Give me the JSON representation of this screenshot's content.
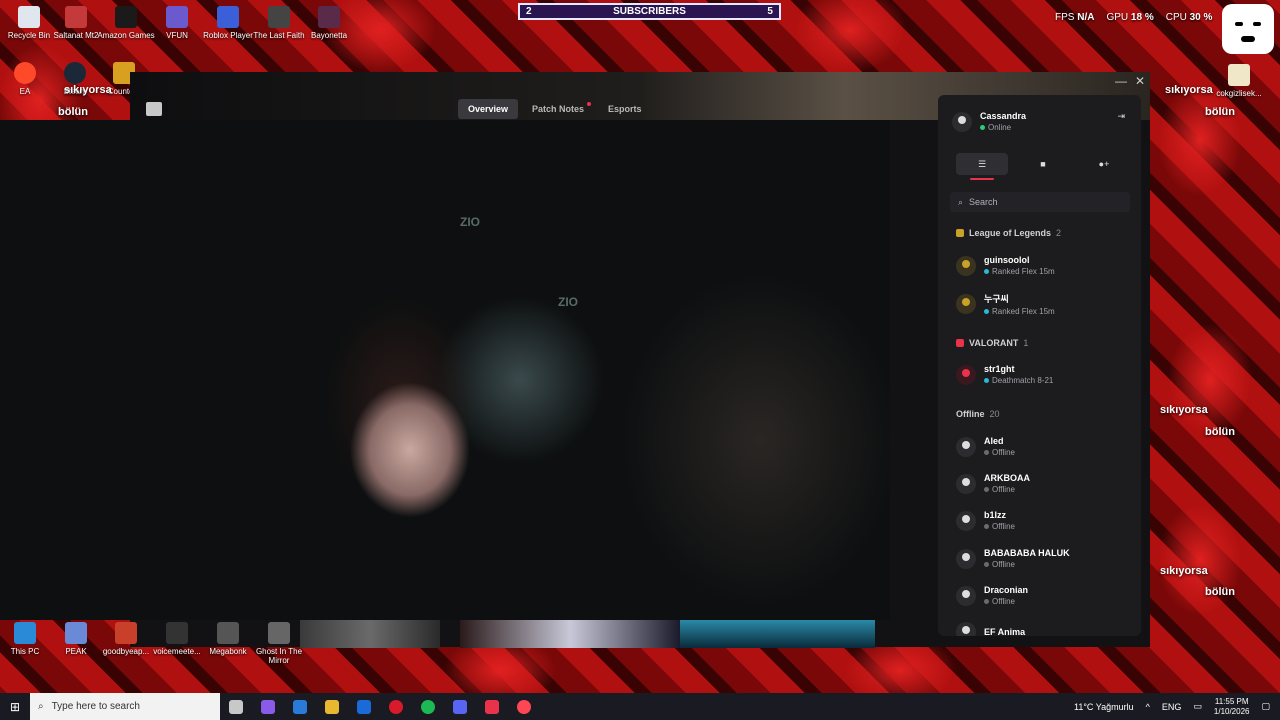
{
  "desktop_icons_top": [
    {
      "label": "Recycle Bin",
      "color": "#dfe6ee"
    },
    {
      "label": "Saltanat Mt2",
      "color": "#c43a3a"
    },
    {
      "label": "Amazon Games",
      "color": "#1a1a1a"
    },
    {
      "label": "VFUN",
      "color": "#6a5acd"
    },
    {
      "label": "Roblox Player",
      "color": "#3a5fd9"
    },
    {
      "label": "The Last Faith",
      "color": "#444"
    },
    {
      "label": "Bayonetta",
      "color": "#5a2a4a"
    }
  ],
  "desktop_icons_second": [
    {
      "label": "EA",
      "color": "#ff4a2a"
    },
    {
      "label": "Steam",
      "color": "#1b2838"
    },
    {
      "label": "Counte...",
      "color": "#d8a020"
    }
  ],
  "desktop_icons_bottom": [
    {
      "label": "This PC",
      "color": "#2a8ad8"
    },
    {
      "label": "PEAK",
      "color": "#6a8ad8"
    },
    {
      "label": "goodbyeap...",
      "color": "#c8402a"
    },
    {
      "label": "voicemeete...",
      "color": "#333"
    },
    {
      "label": "Megabonk",
      "color": "#555"
    },
    {
      "label": "Ghost In The Mirror",
      "color": "#666"
    }
  ],
  "overlay": {
    "subs_left": "2",
    "subs_label": "SUBSCRIBERS",
    "subs_right": "5",
    "fps_label": "FPS",
    "fps_value": "N/A",
    "gpu_label": "GPU",
    "gpu_value": "18 %",
    "cpu_label": "CPU",
    "cpu_value": "30 %",
    "side_text_1": "sıkıyorsa",
    "side_text_2": "bölün",
    "right_icon_label": "cokgizlisek..."
  },
  "client": {
    "tabs": [
      {
        "label": "Overview",
        "active": true
      },
      {
        "label": "Patch Notes",
        "active": false,
        "dot": true
      },
      {
        "label": "Esports",
        "active": false
      }
    ],
    "minimize": "—",
    "close": "✕",
    "video_mark": "ZIO"
  },
  "friends": {
    "me": {
      "name": "Cassandra",
      "status": "Online"
    },
    "collapse_icon": "⇥",
    "search_placeholder": "Search",
    "groups": {
      "lol": {
        "name": "League of Legends",
        "count": "2"
      },
      "valorant": {
        "name": "VALORANT",
        "count": "1"
      },
      "offline": {
        "name": "Offline",
        "count": "20"
      }
    },
    "lol_friends": [
      {
        "name": "guinsoolol",
        "status": "Ranked Flex 15m"
      },
      {
        "name": "누구씨",
        "status": "Ranked Flex 15m"
      }
    ],
    "valorant_friends": [
      {
        "name": "str1ght",
        "status": "Deathmatch 8-21"
      }
    ],
    "offline_friends": [
      {
        "name": "Aled",
        "status": "Offline"
      },
      {
        "name": "ARKBOAA",
        "status": "Offline"
      },
      {
        "name": "b1lzz",
        "status": "Offline"
      },
      {
        "name": "BABABABA HALUK",
        "status": "Offline"
      },
      {
        "name": "Draconian",
        "status": "Offline"
      },
      {
        "name": "EF Anima",
        "status": ""
      }
    ]
  },
  "taskbar": {
    "search_placeholder": "Type here to search",
    "weather": "11°C  Yağmurlu",
    "lang": "ENG",
    "time": "11:55 PM",
    "date": "1/10/2026",
    "apps": [
      {
        "name": "task-view-icon",
        "color": "#c8c8c8"
      },
      {
        "name": "copilot-icon",
        "color": "#8a5ae8"
      },
      {
        "name": "store-icon",
        "color": "#2a7ad8"
      },
      {
        "name": "file-explorer-icon",
        "color": "#e8b830"
      },
      {
        "name": "outlook-icon",
        "color": "#1a6ad8"
      },
      {
        "name": "opera-icon",
        "color": "#d81a2a"
      },
      {
        "name": "spotify-icon",
        "color": "#1db954"
      },
      {
        "name": "discord-icon",
        "color": "#5865f2"
      },
      {
        "name": "riot-icon",
        "color": "#e8334a"
      },
      {
        "name": "valorant-icon",
        "color": "#ff4655"
      }
    ]
  }
}
